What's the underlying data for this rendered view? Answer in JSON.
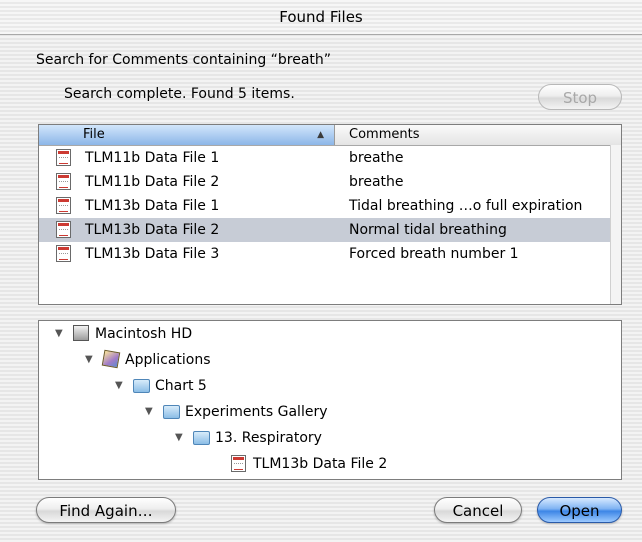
{
  "window": {
    "title": "Found Files"
  },
  "search": {
    "description": "Search for Comments containing “breath”",
    "status": "Search complete. Found 5 items.",
    "stop_label": "Stop"
  },
  "results": {
    "columns": {
      "file": "File",
      "comments": "Comments"
    },
    "rows": [
      {
        "file": "TLM11b Data File 1",
        "comment": "breathe",
        "icon": "document-icon",
        "selected": false
      },
      {
        "file": "TLM11b Data File 2",
        "comment": "breathe",
        "icon": "document-icon",
        "selected": false
      },
      {
        "file": "TLM13b Data File 1",
        "comment": "Tidal breathing …o full expiration",
        "icon": "document-icon",
        "selected": false
      },
      {
        "file": "TLM13b Data File 2",
        "comment": "Normal tidal breathing",
        "icon": "document-icon",
        "selected": true
      },
      {
        "file": "TLM13b Data File 3",
        "comment": "Forced breath number 1",
        "icon": "document-icon",
        "selected": false
      }
    ],
    "sort_column": "File",
    "sort_direction": "ascending"
  },
  "path_tree": {
    "items": [
      {
        "label": "Macintosh HD",
        "icon": "hard-drive-icon",
        "expanded": true
      },
      {
        "label": "Applications",
        "icon": "applications-folder-icon",
        "expanded": true
      },
      {
        "label": "Chart 5",
        "icon": "folder-icon",
        "expanded": true
      },
      {
        "label": "Experiments Gallery",
        "icon": "folder-icon",
        "expanded": true
      },
      {
        "label": "13. Respiratory",
        "icon": "folder-icon",
        "expanded": true
      },
      {
        "label": "TLM13b Data File 2",
        "icon": "document-icon",
        "expanded": false
      }
    ]
  },
  "buttons": {
    "find_again": "Find Again…",
    "cancel": "Cancel",
    "open": "Open"
  },
  "colors": {
    "selection": "#c7ccd6",
    "header_sorted": "#8cb6e8",
    "default_button": "#3d86e6",
    "doc_icon_accent": "#cc3a33"
  }
}
